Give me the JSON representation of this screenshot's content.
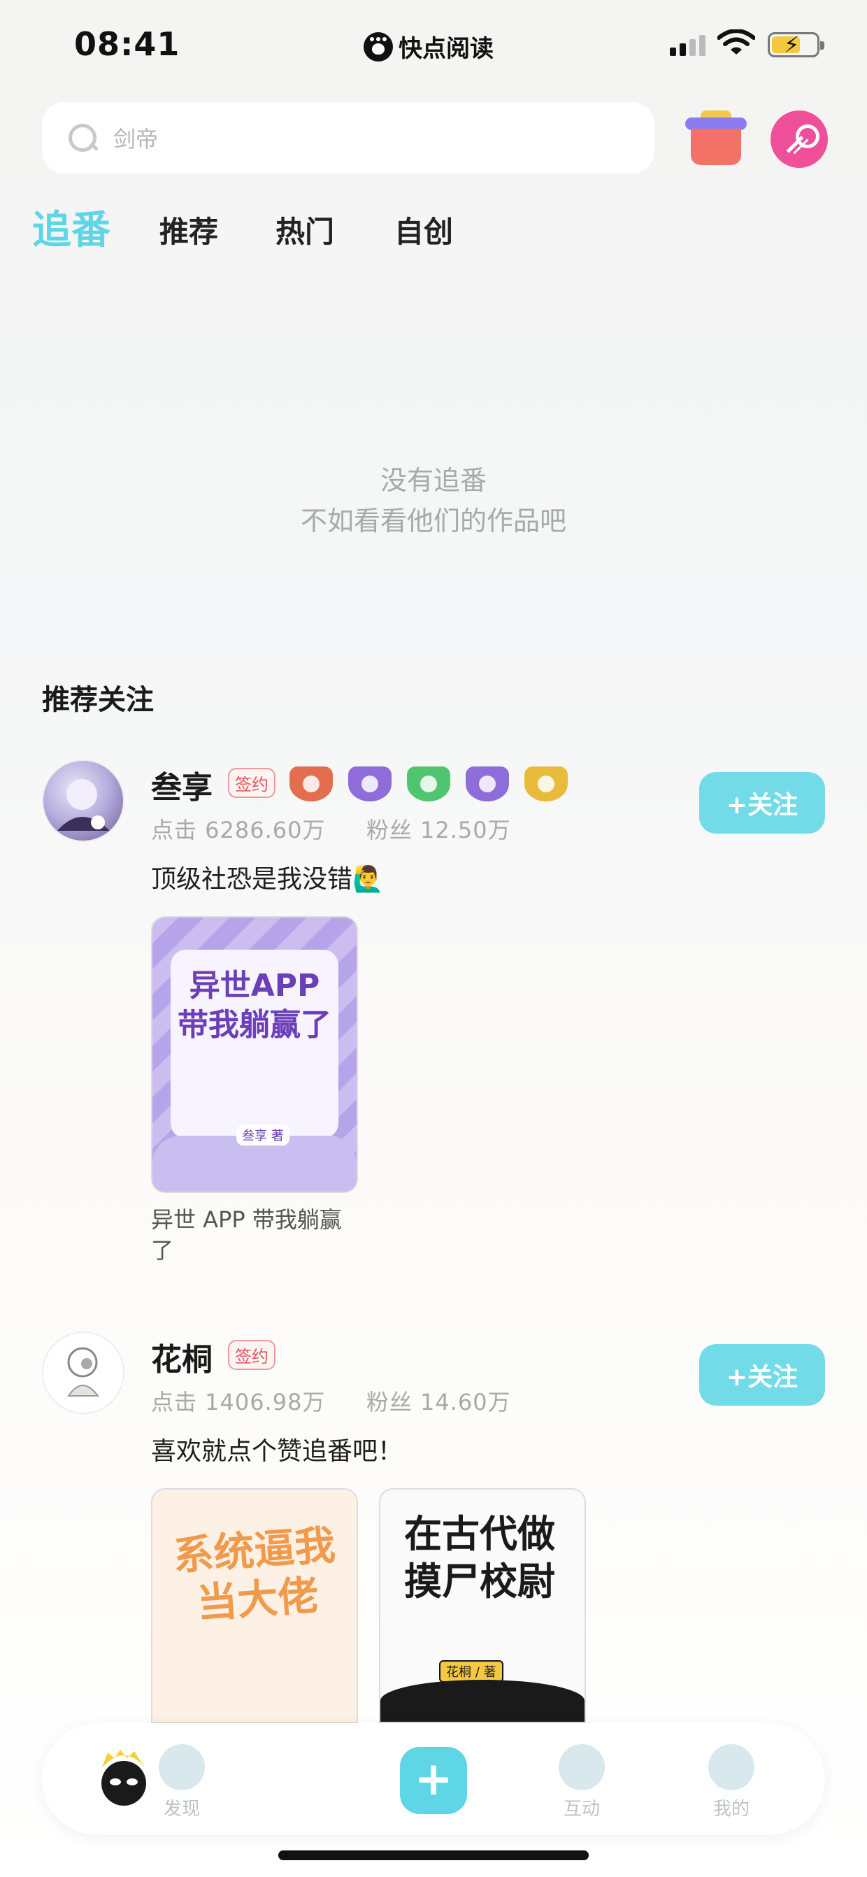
{
  "status_bar": {
    "time": "08:41",
    "app_name": "快点阅读"
  },
  "search": {
    "placeholder": "剑帝"
  },
  "tabs": [
    {
      "label": "追番",
      "active": true
    },
    {
      "label": "推荐",
      "active": false
    },
    {
      "label": "热门",
      "active": false
    },
    {
      "label": "自创",
      "active": false
    }
  ],
  "empty_state": {
    "line1": "没有追番",
    "line2": "不如看看他们的作品吧"
  },
  "section_title": "推荐关注",
  "users": [
    {
      "name": "叁享",
      "tag": "签约",
      "clicks": "点击 6286.60万",
      "fans": "粉丝 12.50万",
      "bio": "顶级社恐是我没错🙋‍♂️",
      "follow_label": "+关注",
      "medals": [
        "bronze",
        "purple",
        "green",
        "purple",
        "gold"
      ],
      "books": [
        {
          "title": "异世 APP 带我躺赢了",
          "cover_text": "异世APP带我躺赢了",
          "author_tag": "叁享 著"
        }
      ]
    },
    {
      "name": "花桐",
      "tag": "签约",
      "clicks": "点击 1406.98万",
      "fans": "粉丝 14.60万",
      "bio": "喜欢就点个赞追番吧！",
      "follow_label": "+关注",
      "medals": [],
      "books": [
        {
          "cover_text": "系统逼我当大佬"
        },
        {
          "cover_text": "在古代做摸尸校尉",
          "author_tag": "花桐 / 著"
        }
      ]
    }
  ],
  "nav": {
    "discover": "发现",
    "interact": "互动",
    "mine": "我的"
  },
  "colors": {
    "accent": "#5fd6e8",
    "follow": "#73dbe7",
    "sign": "#e05a5a"
  }
}
